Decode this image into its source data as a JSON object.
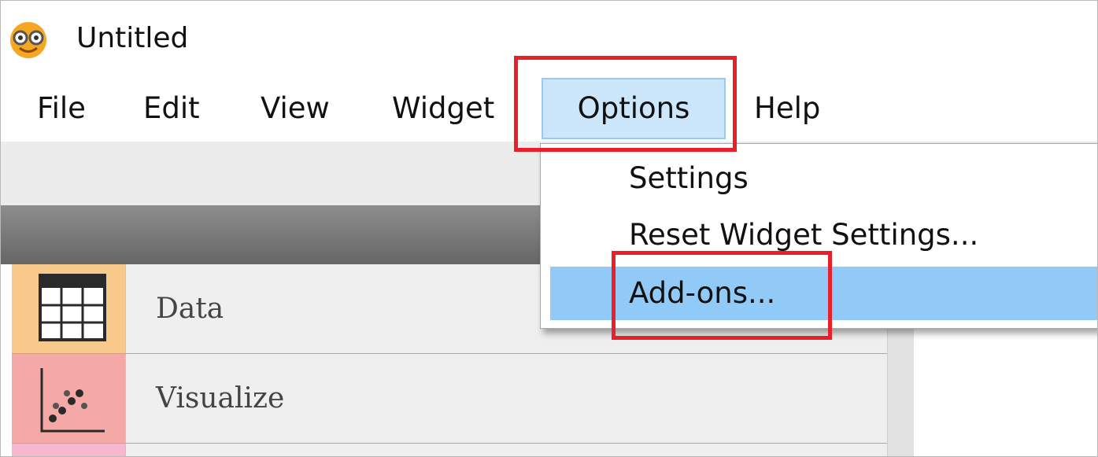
{
  "window": {
    "title": "Untitled"
  },
  "menubar": {
    "items": [
      {
        "label": "File"
      },
      {
        "label": "Edit"
      },
      {
        "label": "View"
      },
      {
        "label": "Widget"
      },
      {
        "label": "Options"
      },
      {
        "label": "Help"
      }
    ]
  },
  "options_menu": {
    "items": [
      {
        "label": "Settings"
      },
      {
        "label": "Reset Widget Settings..."
      },
      {
        "label": "Add-ons..."
      }
    ]
  },
  "widget_categories": [
    {
      "label": "Data",
      "icon": "table-grid-icon",
      "color": "#f7c98b"
    },
    {
      "label": "Visualize",
      "icon": "scatter-plot-icon",
      "color": "#f5a9a6"
    },
    {
      "label": "",
      "icon": "model-icon",
      "color": "#f7b7cf"
    }
  ],
  "colors": {
    "menu_active_bg": "#cce6fb",
    "menu_item_highlight": "#91c9f7",
    "annotation_red": "#e8202a"
  },
  "icons": {
    "app": "orange-mascot-logo-icon"
  }
}
